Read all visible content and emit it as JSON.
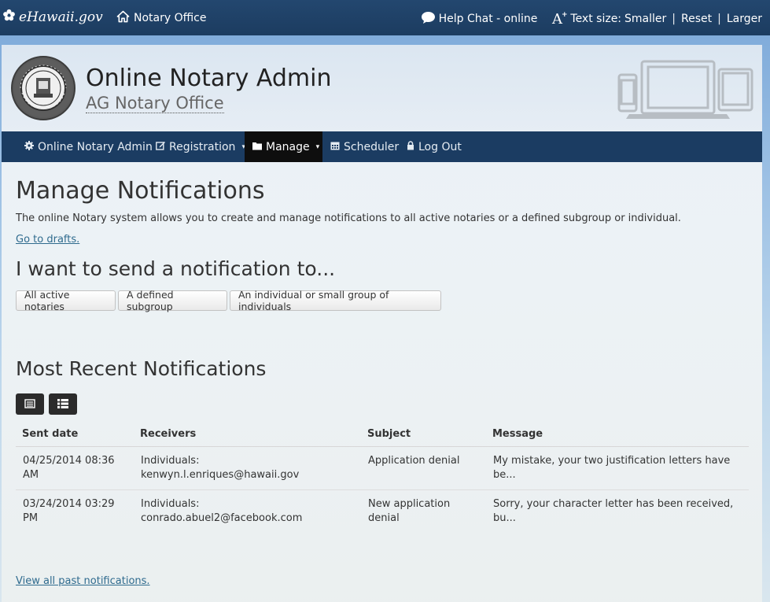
{
  "topbar": {
    "brand": "eHawaii.gov",
    "home_label": "Notary Office",
    "help_chat": "Help Chat - online",
    "text_size_label": "Text size:",
    "smaller": "Smaller",
    "reset": "Reset",
    "larger": "Larger",
    "separator": "|"
  },
  "header": {
    "title": "Online Notary Admin",
    "subtitle": "AG Notary Office"
  },
  "nav": {
    "items": [
      {
        "label": "Online Notary Admin",
        "icon": "gear-icon"
      },
      {
        "label": "Registration",
        "icon": "edit-icon"
      },
      {
        "label": "Manage",
        "icon": "folder-icon"
      },
      {
        "label": "Scheduler",
        "icon": "calendar-icon"
      },
      {
        "label": "Log Out",
        "icon": "lock-icon"
      }
    ]
  },
  "main": {
    "title": "Manage Notifications",
    "intro": "The online Notary system allows you to create and manage notifications to all active notaries or a defined subgroup or individual.",
    "drafts_link": "Go to drafts.",
    "send_heading": "I want to send a notification to...",
    "send_buttons": [
      "All active notaries",
      "A defined subgroup",
      "An individual or small group of individuals"
    ],
    "recent_heading": "Most Recent Notifications",
    "view_all_link": "View all past notifications."
  },
  "table": {
    "headers": [
      "Sent date",
      "Receivers",
      "Subject",
      "Message"
    ],
    "rows": [
      {
        "sent": "04/25/2014 08:36 AM",
        "receivers": "Individuals: kenwyn.l.enriques@hawaii.gov",
        "subject": "Application denial",
        "message": "My mistake, your two justification letters have be..."
      },
      {
        "sent": "03/24/2014 03:29 PM",
        "receivers": "Individuals: conrado.abuel2@facebook.com",
        "subject": "New application denial",
        "message": "Sorry, your character letter has been received, bu..."
      }
    ]
  }
}
